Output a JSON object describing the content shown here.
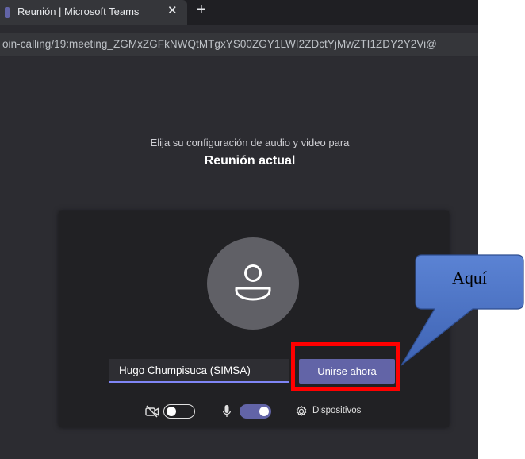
{
  "browser": {
    "tab_title": "Reunión | Microsoft Teams",
    "tab_close": "✕",
    "new_tab": "+",
    "url": "oin-calling/19:meeting_ZGMxZGFkNWQtMTgxYS00ZGY1LWI2ZDctYjMwZTI1ZDY2Y2Vi@"
  },
  "prejoin": {
    "subtitle": "Elija su configuración de audio y video para",
    "meeting_title": "Reunión actual",
    "name_value": "Hugo Chumpisuca (SIMSA)",
    "join_label": "Unirse ahora",
    "camera_on": false,
    "mic_on": true,
    "devices_label": "Dispositivos"
  },
  "annotation": {
    "callout_text": "Aquí",
    "callout_fill": "#4a72c4",
    "highlight_color": "#ff0000"
  },
  "colors": {
    "accent": "#6264a7",
    "background": "#2c2c31",
    "panel": "#212124"
  }
}
